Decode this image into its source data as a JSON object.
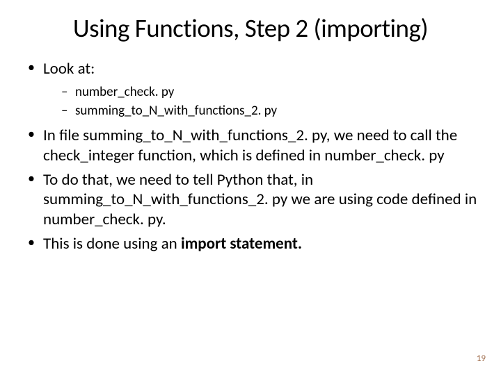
{
  "title": "Using Functions, Step 2 (importing)",
  "bullets": {
    "b1": "Look at:",
    "sub1": "number_check. py",
    "sub2": "summing_to_N_with_functions_2. py",
    "b2": "In file summing_to_N_with_functions_2. py, we need to call the check_integer function, which is defined in number_check. py",
    "b3a": "To do that, we need to tell Python that, in summing_to_N_with_functions_2. py we are using code defined in number_check. py.",
    "b4a": "This is done using an ",
    "b4b": "import statement."
  },
  "page_number": "19"
}
